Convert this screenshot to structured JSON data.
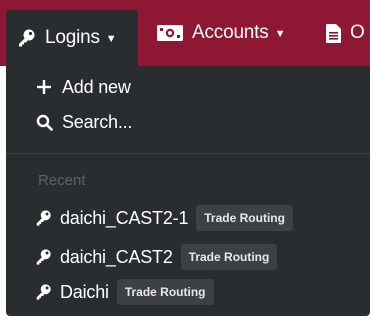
{
  "navbar": {
    "logins_label": "Logins",
    "accounts_label": "Accounts",
    "other_label": "O"
  },
  "dropdown": {
    "add_new_label": "Add new",
    "search_label": "Search...",
    "recent_heading": "Recent",
    "recent_items": [
      {
        "name": "daichi_CAST2-1",
        "badge": "Trade Routing"
      },
      {
        "name": "daichi_CAST2",
        "badge": "Trade Routing"
      },
      {
        "name": "Daichi",
        "badge": "Trade Routing"
      }
    ]
  },
  "colors": {
    "navbar_bg": "#8e1734",
    "dropdown_bg": "#2a2d30",
    "badge_bg": "#3d4146",
    "muted_text": "#5b6066"
  },
  "icons": {
    "logins": "key-icon",
    "accounts": "money-bill-icon",
    "other": "file-icon",
    "add": "plus-icon",
    "search": "search-icon",
    "recent": "key-icon"
  }
}
